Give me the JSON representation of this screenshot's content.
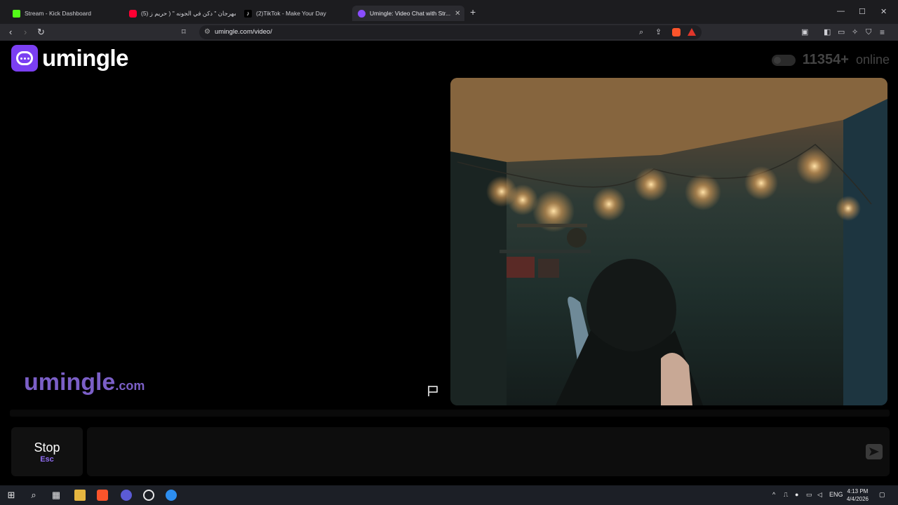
{
  "browser": {
    "tabs": [
      {
        "label": "Stream - Kick Dashboard",
        "icon": "kick-icon",
        "color": "#53fc18"
      },
      {
        "label": "(5) مهرجان \" دكن في الجونه \" ( حريم ز...",
        "icon": "youtube-icon",
        "color": "#ff0033"
      },
      {
        "label": "(2)TikTok - Make Your Day",
        "icon": "tiktok-icon",
        "color": "#ffffff"
      },
      {
        "label": "Umingle: Video Chat with Str...",
        "icon": "umingle-icon",
        "color": "#8a4dff"
      }
    ],
    "url": "umingle.com/video/"
  },
  "page": {
    "logo_text": "umingle",
    "online_count": "11354+",
    "online_label": "online",
    "watermark_main": "umingle",
    "watermark_tld": ".com",
    "stop_label": "Stop",
    "stop_key": "Esc",
    "accent": "#7b3ff2"
  },
  "taskbar": {
    "language": "ENG",
    "time": "4:13 PM",
    "date": "4/4/2026"
  }
}
